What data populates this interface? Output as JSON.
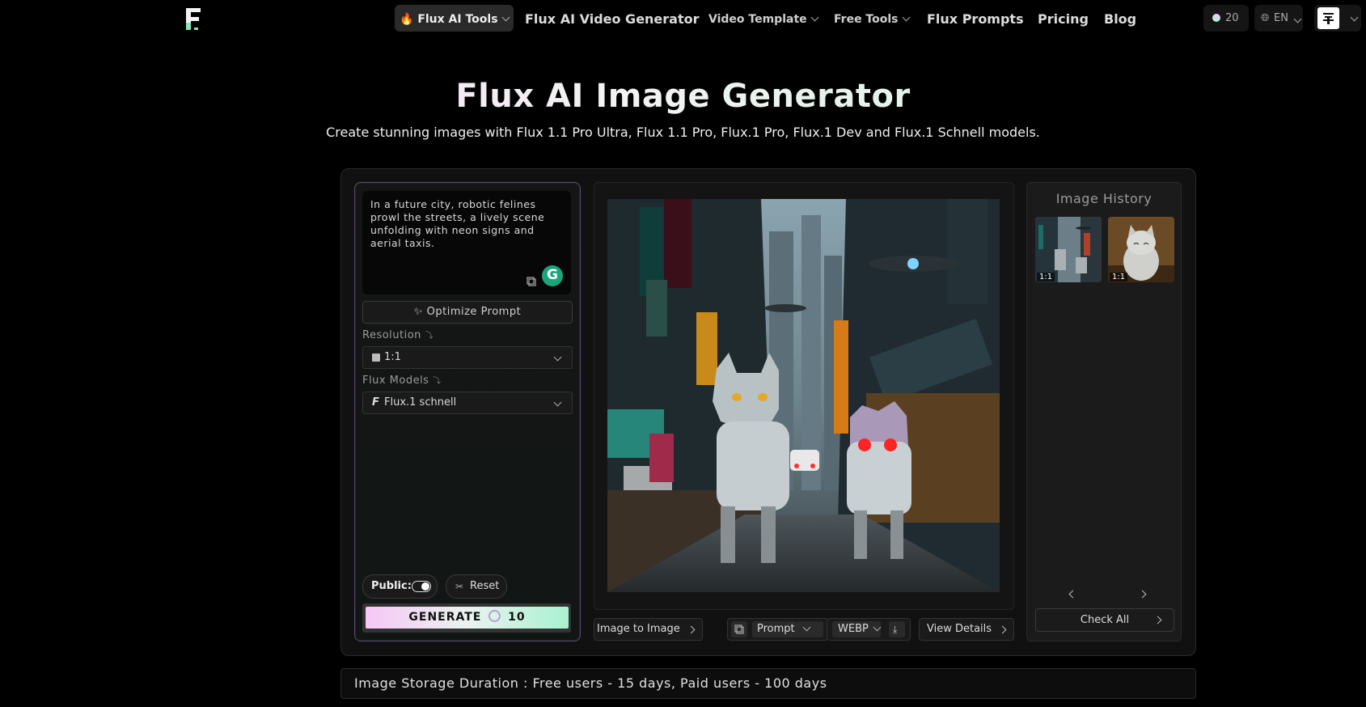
{
  "header": {
    "nav": {
      "tools": "Flux AI Tools",
      "video_generator": "Flux AI Video Generator",
      "video_template": "Video Template",
      "free_tools": "Free Tools",
      "prompts": "Flux Prompts",
      "pricing": "Pricing",
      "blog": "Blog"
    },
    "credits": "20",
    "language": "EN"
  },
  "hero": {
    "title": "Flux AI Image Generator",
    "subtitle": "Create stunning images with Flux 1.1 Pro Ultra, Flux 1.1 Pro, Flux.1 Pro, Flux.1 Dev and Flux.1 Schnell models."
  },
  "form": {
    "prompt": "In a future city, robotic felines prowl the streets, a lively scene unfolding with neon signs and aerial taxis.",
    "optimize_label": "Optimize Prompt",
    "resolution_label": "Resolution",
    "resolution_value": "1:1",
    "model_label": "Flux Models",
    "model_value": "Flux.1 schnell",
    "public_label": "Public:",
    "reset_label": "Reset",
    "generate_label": "GENERATE",
    "generate_cost": "10"
  },
  "toolbar": {
    "image_to_image": "Image to Image",
    "prompt": "Prompt",
    "format": "WEBP",
    "view_details": "View Details"
  },
  "history": {
    "title": "Image History",
    "items": [
      {
        "ratio": "1:1"
      },
      {
        "ratio": "1:1"
      }
    ],
    "check_all": "Check All"
  },
  "footer": {
    "storage_note": "Image Storage Duration : Free users - 15 days, Paid users - 100 days"
  },
  "colors": {
    "accent_pink": "#f7c6f6",
    "accent_green": "#a8f2cf",
    "background": "#000000"
  }
}
